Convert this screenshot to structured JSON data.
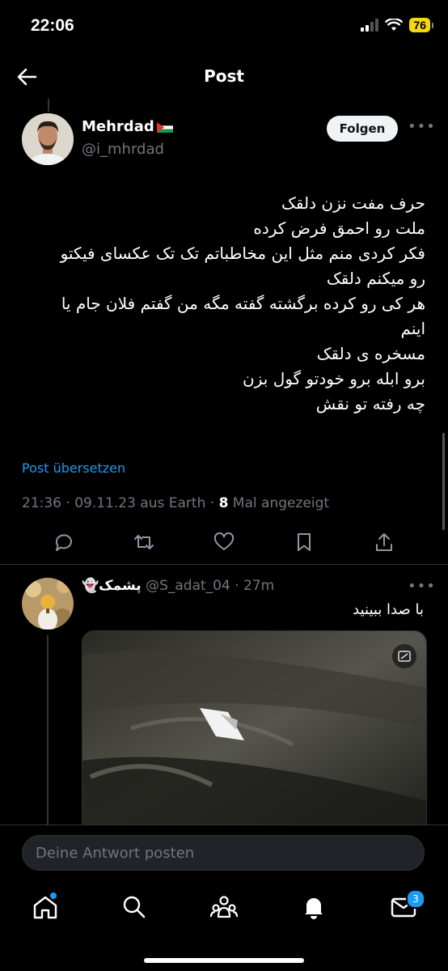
{
  "status": {
    "time": "22:06",
    "battery": "76"
  },
  "nav": {
    "title": "Post"
  },
  "post": {
    "author_name": "Mehrdad",
    "author_handle": "@i_mhrdad",
    "follow_label": "Folgen",
    "lines": [
      "حرف مفت نزن دلقک",
      "ملت رو احمق فرض کرده",
      "فکر کردی منم مثل این مخاطباتم تک تک عکسای فیکتو",
      "رو میکنم دلقک",
      "هر کی رو کرده برگشته گفته مگه من گفتم فلان جام یا",
      "اینم",
      "مسخره ی دلقک",
      "برو ابله برو خودتو گول بزن",
      "چه رفته تو نقش"
    ],
    "translate_label": "Post übersetzen",
    "meta_prefix": "21:36 · 09.11.23 aus Earth · ",
    "views_count": "8",
    "views_suffix": " Mal angezeigt"
  },
  "reply": {
    "name": "پشمک",
    "handle": "@S_adat_04",
    "time": "27m",
    "sep": " · ",
    "text": "با صدا ببینید"
  },
  "compose": {
    "placeholder": "Deine Antwort posten"
  },
  "tabbar": {
    "messages_badge": "3"
  },
  "colors": {
    "accent": "#1d9bf0",
    "background": "#000000",
    "muted": "#71767b"
  }
}
